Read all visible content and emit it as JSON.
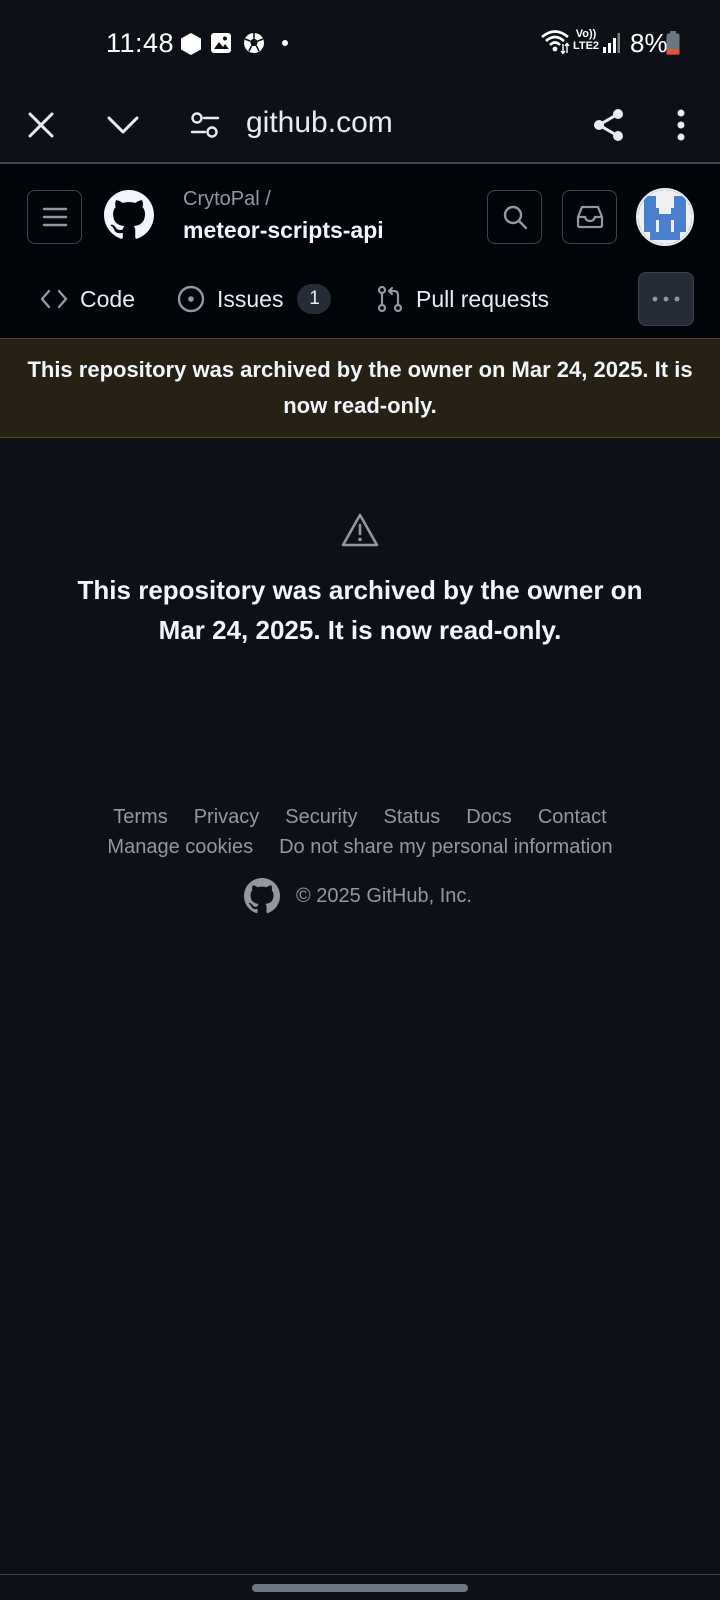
{
  "status_bar": {
    "time": "11:48",
    "notification_icons": [
      "hexagon-icon",
      "image-icon",
      "soccer-ball-icon"
    ],
    "network_label_top": "Vo))",
    "network_label_bottom": "LTE2",
    "battery_percent": "8%",
    "battery_level": 0.08,
    "battery_color": "#e5533d"
  },
  "browser": {
    "url": "github.com",
    "icons": [
      "close-icon",
      "chevron-down-icon",
      "site-settings-icon",
      "share-icon",
      "more-vertical-icon"
    ]
  },
  "header": {
    "owner": "CrytoPal /",
    "repo": "meteor-scripts-api",
    "tabs": [
      {
        "label": "Code",
        "icon": "code-icon"
      },
      {
        "label": "Issues",
        "icon": "issue-opened-icon",
        "count": "1"
      },
      {
        "label": "Pull requests",
        "icon": "git-pull-request-icon"
      }
    ]
  },
  "banner": {
    "text": "This repository was archived by the owner on Mar 24, 2025. It is now read-only."
  },
  "main": {
    "message": "This repository was archived by the owner on Mar 24, 2025. It is now read-only."
  },
  "footer": {
    "links_row1": [
      "Terms",
      "Privacy",
      "Security",
      "Status",
      "Docs",
      "Contact"
    ],
    "links_row2": [
      "Manage cookies",
      "Do not share my personal information"
    ],
    "copyright": "© 2025 GitHub, Inc."
  },
  "colors": {
    "background": "#0d1117",
    "header_background": "#010409",
    "banner_background": "#272115",
    "muted_text": "#9198a1"
  }
}
